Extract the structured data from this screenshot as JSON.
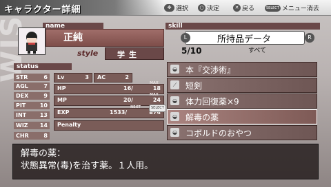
{
  "header": {
    "title": "キャラクター詳細",
    "hints": [
      {
        "icon": "dpad-icon",
        "label": "選択"
      },
      {
        "icon": "circle-button-icon",
        "label": "決定"
      },
      {
        "icon": "cross-button-icon",
        "label": "戻る"
      },
      {
        "icon": "select-button-icon",
        "icon_text": "SELECT",
        "label": "メニュー消去"
      }
    ]
  },
  "profile": {
    "name_tab": "name",
    "name": "正純",
    "style_label": "style",
    "style_value": "学生"
  },
  "status": {
    "tab": "status",
    "stats": [
      {
        "label": "STR",
        "value": "6"
      },
      {
        "label": "AGL",
        "value": "7"
      },
      {
        "label": "DEX",
        "value": "9"
      },
      {
        "label": "PIT",
        "value": "10"
      },
      {
        "label": "INT",
        "value": "13"
      },
      {
        "label": "WIZ",
        "value": "14"
      },
      {
        "label": "CHR",
        "value": "8"
      }
    ],
    "lv_label": "Lv",
    "lv_value": "3",
    "ac_label": "AC",
    "ac_value": "2",
    "hp_label": "HP",
    "hp_value": "16/",
    "hp_max_label": "MAX",
    "hp_max": "18",
    "mp_label": "MP",
    "mp_value": "20/",
    "mp_max_label": "MAX",
    "mp_max": "24",
    "exp_label": "EXP",
    "exp_value": "1533/",
    "exp_next_label": "NEXT",
    "exp_next": "874",
    "penalty_label": "Penalty",
    "select_badge": "SELECT"
  },
  "skill": {
    "tab": "skill",
    "category_tab": "所持品データ",
    "l_button": "L",
    "r_button": "R",
    "page": "5/10",
    "filter": "すべて",
    "items": [
      {
        "label": "本『交渉術』",
        "icon": "pouch-icon",
        "selected": false
      },
      {
        "label": "短剣",
        "icon": "sword-icon",
        "selected": false
      },
      {
        "label": "体力回復薬×9",
        "icon": "pouch-icon",
        "selected": false
      },
      {
        "label": "解毒の薬",
        "icon": "pouch-icon",
        "selected": true
      },
      {
        "label": "コボルドのおやつ",
        "icon": "pouch-icon",
        "selected": false
      }
    ]
  },
  "description": {
    "title": "解毒の薬：",
    "body": "状態異常(毒)を治す薬。１人用。"
  }
}
